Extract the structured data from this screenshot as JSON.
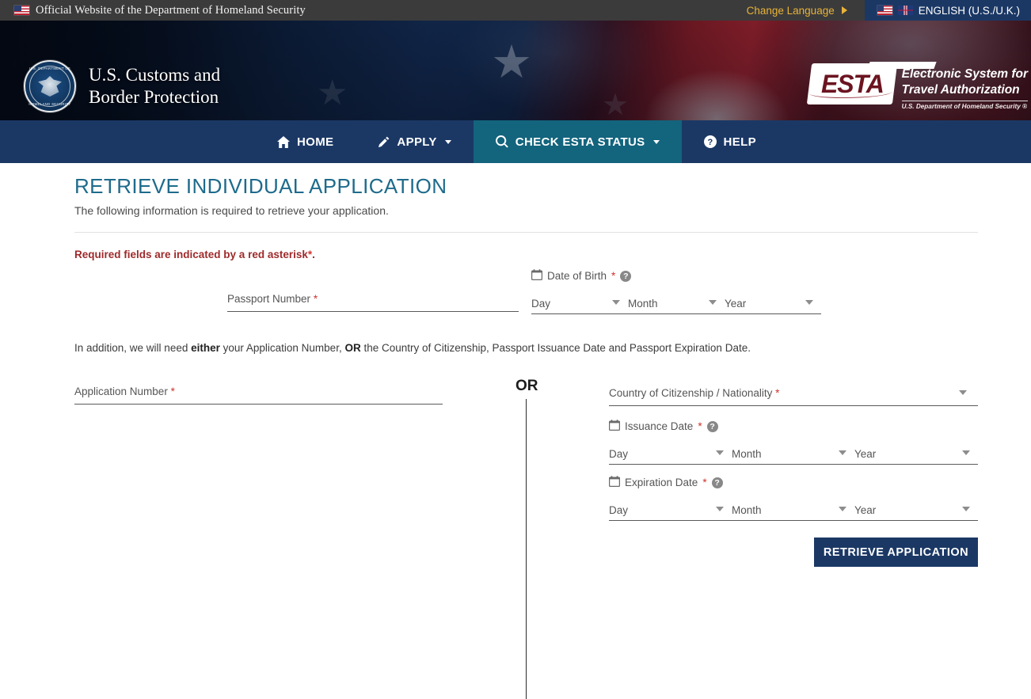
{
  "topbar": {
    "official_site_text": "Official Website of the Department of Homeland Security",
    "change_language": "Change Language",
    "language_selected": "ENGLISH (U.S./U.K.)"
  },
  "header": {
    "agency_line1": "U.S. Customs and",
    "agency_line2": "Border Protection",
    "esta_mark": "ESTA",
    "esta_line1": "Electronic System for",
    "esta_line2": "Travel Authorization",
    "esta_sub": "U.S. Department of Homeland Security ®",
    "seal_top": "U.S. DEPARTMENT OF",
    "seal_bottom": "HOMELAND SECURITY"
  },
  "nav": {
    "items": [
      {
        "label": "HOME",
        "icon": "home-icon",
        "caret": false,
        "active": false
      },
      {
        "label": "APPLY",
        "icon": "pencil-icon",
        "caret": true,
        "active": false
      },
      {
        "label": "CHECK ESTA STATUS",
        "icon": "search-icon",
        "caret": true,
        "active": true
      },
      {
        "label": "HELP",
        "icon": "question-circle-icon",
        "caret": false,
        "active": false
      }
    ]
  },
  "main": {
    "title": "RETRIEVE INDIVIDUAL APPLICATION",
    "subtitle": "The following information is required to retrieve your application.",
    "required_note_text": "Required fields are indicated by a red asterisk",
    "required_note_asterisk": "*",
    "required_note_period": ".",
    "addendum_pre": "In addition, we will need ",
    "addendum_bold1": "either",
    "addendum_mid": " your Application Number, ",
    "addendum_bold2": "OR",
    "addendum_post": " the Country of Citizenship, Passport Issuance Date and Passport Expiration Date.",
    "or_divider": "OR",
    "submit_label": "RETRIEVE APPLICATION"
  },
  "fields": {
    "passport_number": {
      "label": "Passport Number",
      "required": "*",
      "value": ""
    },
    "date_of_birth": {
      "label": "Date of Birth",
      "required": "*",
      "day": "Day",
      "month": "Month",
      "year": "Year"
    },
    "application_number": {
      "label": "Application Number",
      "required": "*",
      "value": ""
    },
    "country_of_citizenship": {
      "label": "Country of Citizenship / Nationality",
      "required": "*",
      "value": ""
    },
    "issuance_date": {
      "label": "Issuance Date",
      "required": "*",
      "day": "Day",
      "month": "Month",
      "year": "Year"
    },
    "expiration_date": {
      "label": "Expiration Date",
      "required": "*",
      "day": "Day",
      "month": "Month",
      "year": "Year"
    }
  },
  "colors": {
    "topbar_bg": "#3b3b3b",
    "navy": "#1b3865",
    "nav_active": "#13647d",
    "title_teal": "#1e6b8c",
    "gold": "#e8b33a",
    "required_red": "#9e2a2b",
    "asterisk_red": "#d0342c"
  }
}
